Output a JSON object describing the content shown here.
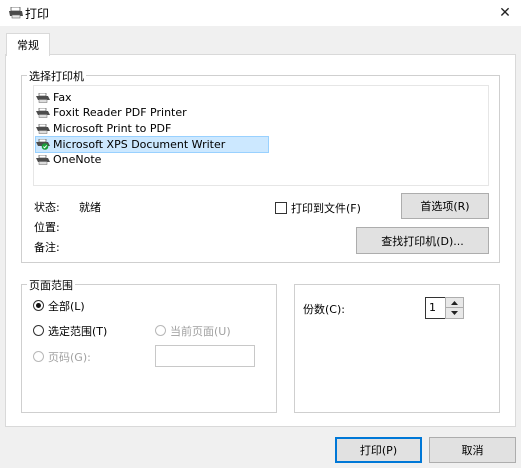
{
  "window": {
    "title": "打印",
    "close_glyph": "✕"
  },
  "tabs": [
    {
      "label": "常规",
      "active": true
    }
  ],
  "select_printer": {
    "legend": "选择打印机",
    "printers": [
      {
        "name": "Fax",
        "icon": "printer-icon",
        "selected": false
      },
      {
        "name": "Foxit Reader PDF Printer",
        "icon": "printer-icon",
        "selected": false
      },
      {
        "name": "Microsoft Print to PDF",
        "icon": "printer-icon",
        "selected": false
      },
      {
        "name": "Microsoft XPS Document Writer",
        "icon": "default-printer-icon",
        "selected": true
      },
      {
        "name": "OneNote",
        "icon": "printer-icon",
        "selected": false
      }
    ],
    "status_label": "状态:",
    "status_value": "就绪",
    "location_label": "位置:",
    "comment_label": "备注:",
    "print_to_file_label": "打印到文件(F)",
    "print_to_file_checked": false,
    "preferences_button": "首选项(R)",
    "find_printer_button": "查找打印机(D)..."
  },
  "page_range": {
    "legend": "页面范围",
    "all_label": "全部(L)",
    "selection_label": "选定范围(T)",
    "current_page_label": "当前页面(U)",
    "pages_label": "页码(G):",
    "pages_value": "",
    "selected_option": "all"
  },
  "copies": {
    "label": "份数(C):",
    "value": "1"
  },
  "footer": {
    "print_button": "打印(P)",
    "cancel_button": "取消"
  },
  "colors": {
    "selection_bg": "#cce8ff",
    "selection_border": "#99d1ff",
    "primary_border": "#0078d7"
  }
}
